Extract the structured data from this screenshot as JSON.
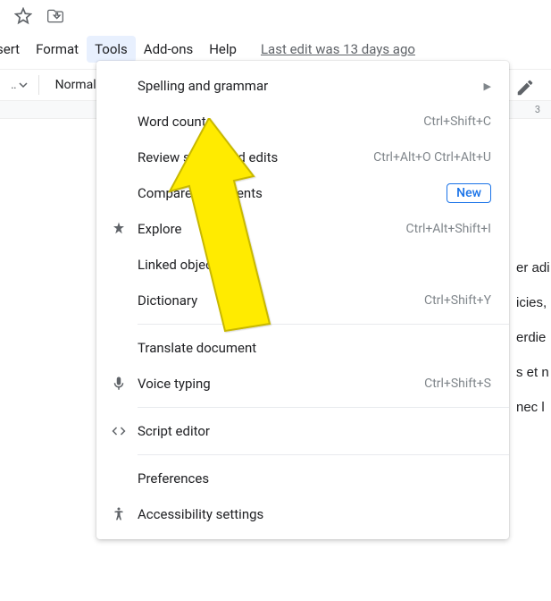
{
  "menubar": {
    "items": [
      "sert",
      "Format",
      "Tools",
      "Add-ons",
      "Help"
    ],
    "last_edit": "Last edit was 13 days ago"
  },
  "toolbar": {
    "style_label": "Normal",
    "ruler_mark": "3"
  },
  "dropdown": {
    "items": [
      {
        "label": "Spelling and grammar",
        "shortcut": "",
        "icon": "",
        "arrow": true
      },
      {
        "label": "Word count",
        "shortcut": "Ctrl+Shift+C",
        "icon": ""
      },
      {
        "label": "Review suggested edits",
        "shortcut": "Ctrl+Alt+O Ctrl+Alt+U",
        "icon": ""
      },
      {
        "label": "Compare documents",
        "shortcut": "",
        "icon": "",
        "badge": "New"
      },
      {
        "label": "Explore",
        "shortcut": "Ctrl+Alt+Shift+I",
        "icon": "explore"
      },
      {
        "label": "Linked objects",
        "shortcut": "",
        "icon": ""
      },
      {
        "label": "Dictionary",
        "shortcut": "Ctrl+Shift+Y",
        "icon": ""
      },
      {
        "divider": true
      },
      {
        "label": "Translate document",
        "shortcut": "",
        "icon": ""
      },
      {
        "label": "Voice typing",
        "shortcut": "Ctrl+Shift+S",
        "icon": "mic"
      },
      {
        "divider": true
      },
      {
        "label": "Script editor",
        "shortcut": "",
        "icon": "code"
      },
      {
        "divider": true
      },
      {
        "label": "Preferences",
        "shortcut": "",
        "icon": ""
      },
      {
        "label": "Accessibility settings",
        "shortcut": "",
        "icon": "accessibility"
      }
    ]
  },
  "doc_fragments": [
    "er adi",
    "icies,",
    "erdie",
    "s et n",
    "nec l"
  ]
}
